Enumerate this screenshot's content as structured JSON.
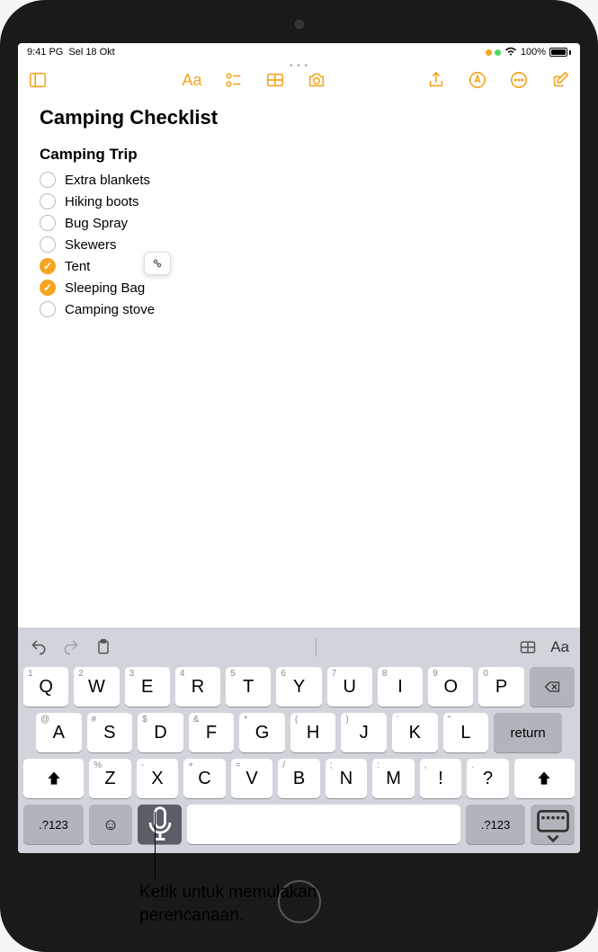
{
  "status": {
    "time": "9:41 PG",
    "date": "Sel 18 Okt",
    "battery_pct": "100%"
  },
  "note": {
    "title": "Camping Checklist",
    "subhead": "Camping Trip",
    "items": [
      {
        "label": "Extra blankets",
        "checked": false
      },
      {
        "label": "Hiking boots",
        "checked": false
      },
      {
        "label": "Bug Spray",
        "checked": false
      },
      {
        "label": "Skewers",
        "checked": false
      },
      {
        "label": "Tent",
        "checked": true
      },
      {
        "label": "Sleeping Bag",
        "checked": true
      },
      {
        "label": "Camping stove",
        "checked": false
      }
    ]
  },
  "keyboard": {
    "row1": [
      {
        "main": "Q",
        "sub": "1"
      },
      {
        "main": "W",
        "sub": "2"
      },
      {
        "main": "E",
        "sub": "3"
      },
      {
        "main": "R",
        "sub": "4"
      },
      {
        "main": "T",
        "sub": "5"
      },
      {
        "main": "Y",
        "sub": "6"
      },
      {
        "main": "U",
        "sub": "7"
      },
      {
        "main": "I",
        "sub": "8"
      },
      {
        "main": "O",
        "sub": "9"
      },
      {
        "main": "P",
        "sub": "0"
      }
    ],
    "row2": [
      {
        "main": "A",
        "sub": "@"
      },
      {
        "main": "S",
        "sub": "#"
      },
      {
        "main": "D",
        "sub": "$"
      },
      {
        "main": "F",
        "sub": "&"
      },
      {
        "main": "G",
        "sub": "*"
      },
      {
        "main": "H",
        "sub": "("
      },
      {
        "main": "J",
        "sub": ")"
      },
      {
        "main": "K",
        "sub": "'"
      },
      {
        "main": "L",
        "sub": "\""
      }
    ],
    "row3": [
      {
        "main": "Z",
        "sub": "%"
      },
      {
        "main": "X",
        "sub": "-"
      },
      {
        "main": "C",
        "sub": "+"
      },
      {
        "main": "V",
        "sub": "="
      },
      {
        "main": "B",
        "sub": "/"
      },
      {
        "main": "N",
        "sub": ";"
      },
      {
        "main": "M",
        "sub": ":"
      },
      {
        "main": "!",
        "sub": ","
      },
      {
        "main": "?",
        "sub": "."
      }
    ],
    "return_label": "return",
    "numkey_label": ".?123"
  },
  "callout": {
    "text": "Ketik untuk memulakan perencanaan."
  },
  "colors": {
    "accent": "#f5a623"
  }
}
